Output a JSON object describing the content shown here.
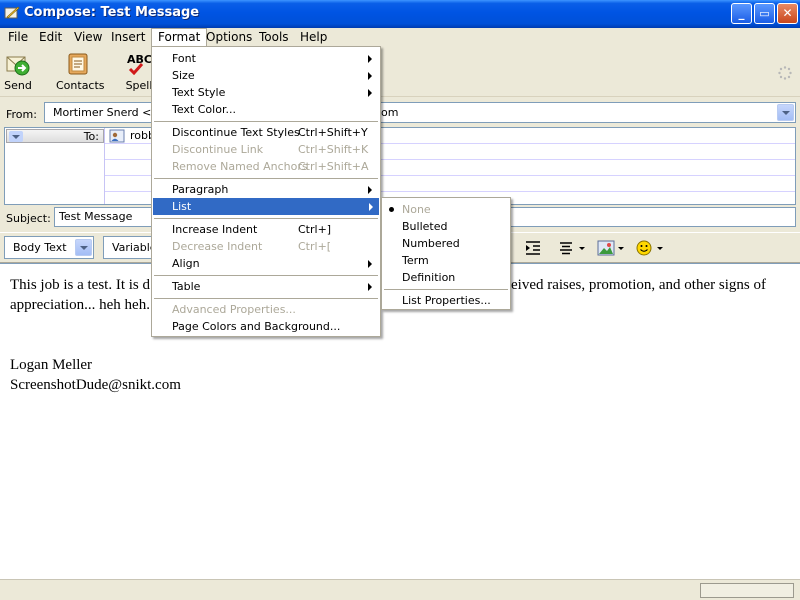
{
  "window": {
    "title": "Compose: Test Message",
    "controls": {
      "minimize": "_",
      "maximize": "▭",
      "close": "✕"
    }
  },
  "menubar": {
    "items": [
      "File",
      "Edit",
      "View",
      "Insert",
      "Format",
      "Options",
      "Tools",
      "Help"
    ],
    "active": "Format"
  },
  "toolbar": {
    "send": "Send",
    "contacts": "Contacts",
    "spell": "Spell",
    "spell_icon_text": "ABC"
  },
  "compose": {
    "from_label": "From:",
    "from_value": "Mortimer Snerd <use",
    "from_value_suffix": "om",
    "to_label": "To:",
    "to_value": "robb",
    "subject_label": "Subject:",
    "subject_value": "Test Message"
  },
  "format_bar": {
    "paragraph_style": "Body Text",
    "font": "Variable"
  },
  "body": {
    "line1_left": "This job is a test.  It is d",
    "line1_right": "eived raises, promotion, and other signs of",
    "line2": "appreciation... heh heh.",
    "signature_name": "Logan Meller",
    "signature_email": "ScreenshotDude@snikt.com"
  },
  "format_menu": {
    "items": [
      {
        "label": "Font",
        "submenu": true
      },
      {
        "label": "Size",
        "submenu": true
      },
      {
        "label": "Text Style",
        "submenu": true
      },
      {
        "label": "Text Color..."
      },
      {
        "separator": true
      },
      {
        "label": "Discontinue Text Styles",
        "shortcut": "Ctrl+Shift+Y"
      },
      {
        "label": "Discontinue Link",
        "shortcut": "Ctrl+Shift+K",
        "disabled": true
      },
      {
        "label": "Remove Named Anchors",
        "shortcut": "Ctrl+Shift+A",
        "disabled": true
      },
      {
        "separator": true
      },
      {
        "label": "Paragraph",
        "submenu": true
      },
      {
        "label": "List",
        "submenu": true,
        "highlighted": true
      },
      {
        "separator": true
      },
      {
        "label": "Increase Indent",
        "shortcut": "Ctrl+]"
      },
      {
        "label": "Decrease Indent",
        "shortcut": "Ctrl+[",
        "disabled": true
      },
      {
        "label": "Align",
        "submenu": true
      },
      {
        "separator": true
      },
      {
        "label": "Table",
        "submenu": true
      },
      {
        "separator": true
      },
      {
        "label": "Advanced Properties...",
        "disabled": true
      },
      {
        "label": "Page Colors and Background..."
      }
    ]
  },
  "list_submenu": {
    "items": [
      {
        "label": "None",
        "disabled": true,
        "checked": true
      },
      {
        "label": "Bulleted"
      },
      {
        "label": "Numbered"
      },
      {
        "label": "Term"
      },
      {
        "label": "Definition"
      },
      {
        "separator": true
      },
      {
        "label": "List Properties..."
      }
    ]
  },
  "colors": {
    "titlebar": "#0054e3",
    "menu_highlight": "#316ac5",
    "disabled_text": "#aca899"
  }
}
